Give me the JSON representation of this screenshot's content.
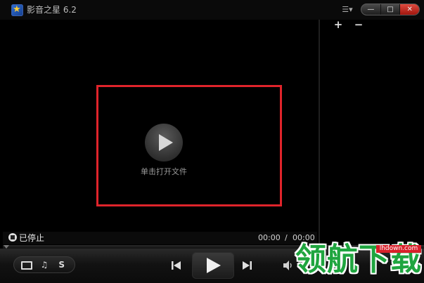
{
  "window": {
    "title": "影音之星 6.2",
    "menu_icon": "menu-list-icon",
    "controls": [
      "minimize-icon",
      "maximize-icon",
      "close-icon"
    ],
    "controls_glyphs": [
      "—",
      "□",
      "✕"
    ]
  },
  "video": {
    "open_file_label": "单击打开文件",
    "play_icon": "play-circle-icon",
    "highlight_color": "#e0242b"
  },
  "playlist": {
    "add_label": "+",
    "remove_label": "−"
  },
  "status": {
    "text": "已停止",
    "time_current": "00:00",
    "time_separator": "/",
    "time_total": "00:00"
  },
  "controls": {
    "toggles": [
      {
        "name": "screen-toggle-icon",
        "label": ""
      },
      {
        "name": "music-note-icon",
        "label": "♫"
      },
      {
        "name": "subtitle-toggle",
        "label": "S"
      }
    ],
    "prev_icon": "previous-track-icon",
    "play_icon": "play-icon",
    "next_icon": "next-track-icon",
    "volume_icon": "volume-icon"
  },
  "watermark": {
    "site": "lhdown.com",
    "text": "领航下载",
    "color": "#1fa53f"
  }
}
